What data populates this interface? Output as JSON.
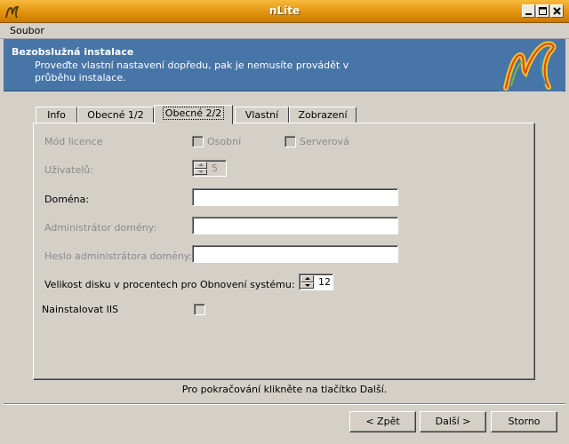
{
  "window": {
    "title": "nLite",
    "controls": [
      "minimize-icon",
      "maximize-icon",
      "close-icon"
    ]
  },
  "menu": {
    "items": [
      "Soubor"
    ]
  },
  "header": {
    "title": "Bezobslužná instalace",
    "description": "Proveďte vlastní nastavení dopředu, pak je nemusíte provádět v průběhu instalace."
  },
  "tabs": [
    {
      "label": "Info",
      "active": false
    },
    {
      "label": "Obecné 1/2",
      "active": false
    },
    {
      "label": "Obecné 2/2",
      "active": true
    },
    {
      "label": "Vlastní",
      "active": false
    },
    {
      "label": "Zobrazení",
      "active": false
    }
  ],
  "form": {
    "license_mode_label": "Mód licence",
    "license_personal_label": "Osobní",
    "license_server_label": "Serverová",
    "users_label": "Uživatelů:",
    "users_value": "5",
    "domain_label": "Doména:",
    "domain_value": "",
    "domain_admin_label": "Administrátor domény:",
    "domain_admin_value": "",
    "domain_admin_password_label": "Heslo administrátora domény:",
    "domain_admin_password_value": "",
    "restore_disk_label": "Velikost disku v procentech pro Obnovení systému:",
    "restore_disk_value": "12",
    "install_iis_label": "Nainstalovat IIS",
    "install_iis_checked": false
  },
  "footer": {
    "hint": "Pro pokračování klikněte na tlačítko Další.",
    "back_label": "< Zpět",
    "next_label": "Další >",
    "cancel_label": "Storno"
  },
  "colors": {
    "titlebar": "#e2940e",
    "banner": "#4775a8",
    "window_bg": "#d4d0c8",
    "disabled_text": "#8a8a8a"
  }
}
